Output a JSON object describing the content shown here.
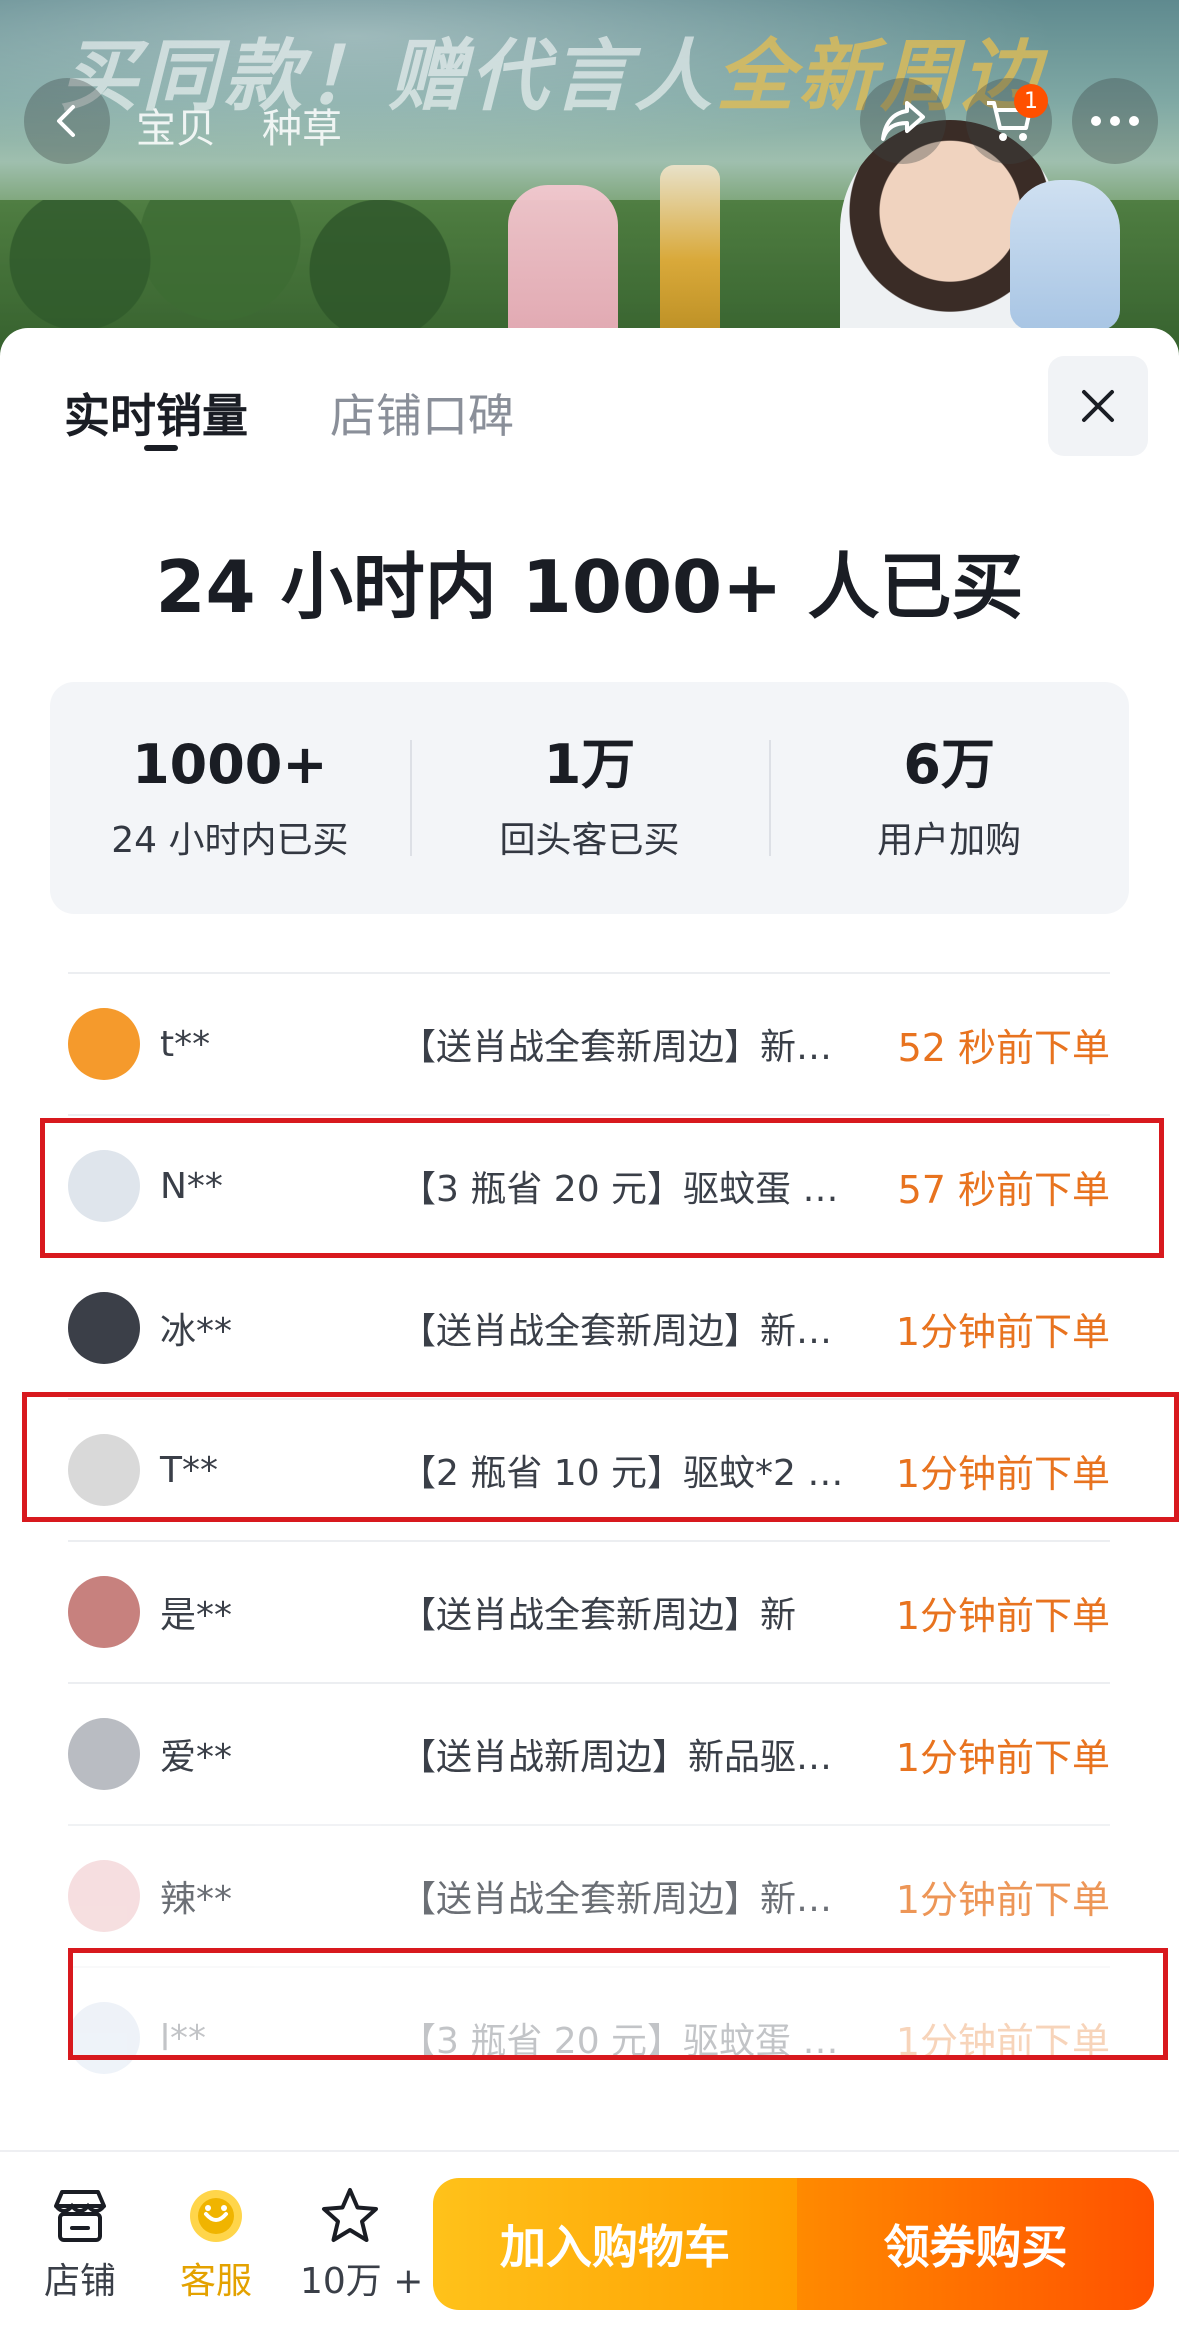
{
  "banner": {
    "headline_part1": "买同款！赠代言人",
    "headline_part2": "全新周边",
    "nav_tabs": [
      "宝贝",
      "种草"
    ],
    "cart_badge": "1"
  },
  "tabs": {
    "active": "实时销量",
    "inactive": "店铺口碑"
  },
  "headline": "24 小时内 1000+ 人已买",
  "stats": [
    {
      "value": "1000+",
      "label": "24 小时内已买"
    },
    {
      "value": "1万",
      "label": "回头客已买"
    },
    {
      "value": "6万",
      "label": "用户加购"
    }
  ],
  "orders": [
    {
      "user": "t**",
      "product": "【送肖战全套新周边】新…",
      "time": "52 秒前下单",
      "avatar_color": "#f59a2c"
    },
    {
      "user": "N**",
      "product": "【3 瓶省 20 元】驱蚊蛋 4…",
      "time": "57 秒前下单",
      "avatar_color": "#dfe5ec"
    },
    {
      "user": "冰**",
      "product": "【送肖战全套新周边】新…",
      "time": "1分钟前下单",
      "avatar_color": "#3b3f48"
    },
    {
      "user": "T**",
      "product": "【2 瓶省 10 元】驱蚊*2 …",
      "time": "1分钟前下单",
      "avatar_color": "#d9d9d9"
    },
    {
      "user": "是**",
      "product": "【送肖战全套新周边】新",
      "time": "1分钟前下单",
      "avatar_color": "#c7817e"
    },
    {
      "user": "爱**",
      "product": "【送肖战新周边】新品驱…",
      "time": "1分钟前下单",
      "avatar_color": "#b9bcc2"
    },
    {
      "user": "辣**",
      "product": "【送肖战全套新周边】新…",
      "time": "1分钟前下单",
      "avatar_color": "#f3d4d6"
    },
    {
      "user": "l**",
      "product": "【3 瓶省 20 元】驱蚊蛋 4…",
      "time": "1分钟前下单",
      "avatar_color": "#c8d6ea"
    }
  ],
  "bottom_bar": {
    "store_label": "店铺",
    "service_label": "客服",
    "fav_label": "10万 +",
    "add_cart_label": "加入购物车",
    "buy_label": "领券购买"
  },
  "colors": {
    "accent_orange": "#e8731f",
    "highlight_red": "#d8191e",
    "cart_yellow": "#ffb300",
    "buy_orange": "#ff5a00"
  }
}
